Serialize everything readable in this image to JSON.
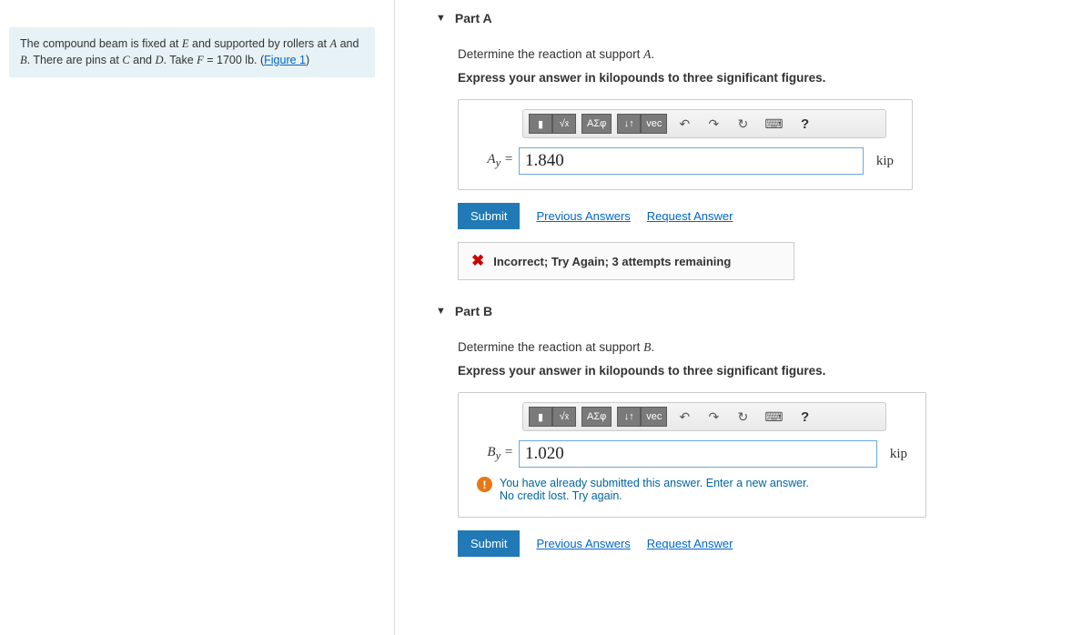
{
  "problem": {
    "text_prefix": "The compound beam is fixed at ",
    "E": "E",
    "text_mid1": " and supported by rollers at ",
    "A": "A",
    "text_mid2": " and ",
    "B": "B",
    "text_mid3": ". There are pins at ",
    "C": "C",
    "text_mid4": " and ",
    "D": "D",
    "text_mid5": ". Take ",
    "F": "F",
    "eq": " = 1700 lb. (",
    "figure_link": "Figure 1",
    "close": ")"
  },
  "toolbar": {
    "templates": "▮",
    "sqrt": "√",
    "frac": "x̄",
    "greek": "ΑΣφ",
    "arrows": "↓↑",
    "vec": "vec",
    "undo": "↶",
    "redo": "↷",
    "reset": "↻",
    "keyboard": "⌨",
    "help": "?"
  },
  "partA": {
    "title": "Part A",
    "prompt_pre": "Determine the reaction at support ",
    "prompt_var": "A",
    "prompt_post": ".",
    "instruction": "Express your answer in kilopounds to three significant figures.",
    "var_letter": "A",
    "var_sub": "y",
    "eq": " = ",
    "value": "1.840",
    "unit": "kip",
    "submit": "Submit",
    "prev": "Previous Answers",
    "req": "Request Answer",
    "feedback": "Incorrect; Try Again; 3 attempts remaining"
  },
  "partB": {
    "title": "Part B",
    "prompt_pre": "Determine the reaction at support ",
    "prompt_var": "B",
    "prompt_post": ".",
    "instruction": "Express your answer in kilopounds to three significant figures.",
    "var_letter": "B",
    "var_sub": "y",
    "eq": " = ",
    "value": "1.020",
    "unit": "kip",
    "info_line1": "You have already submitted this answer. Enter a new answer.",
    "info_line2": "No credit lost. Try again.",
    "submit": "Submit",
    "prev": "Previous Answers",
    "req": "Request Answer"
  }
}
